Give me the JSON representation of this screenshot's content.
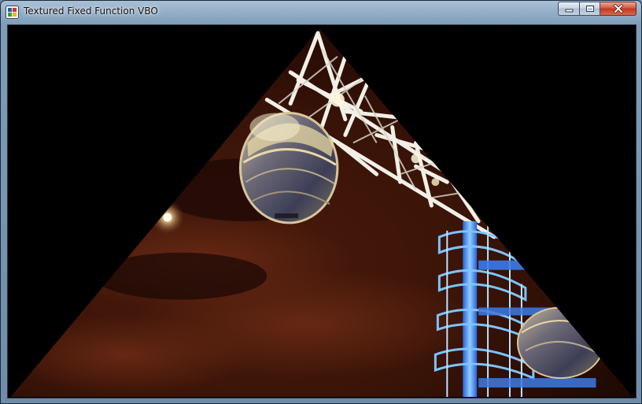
{
  "window": {
    "title": "Textured Fixed Function VBO",
    "icon": "app-window-icon"
  },
  "caption_buttons": {
    "minimize_icon": "minimize-icon",
    "maximize_icon": "maximize-icon",
    "close_icon": "close-icon"
  },
  "viewport": {
    "background": "#000000",
    "content": "textured-triangle"
  },
  "colors": {
    "sky_dark": "#1a0804",
    "sky_warm": "#5a2010",
    "structure_white": "#f2efe6",
    "staircase_blue": "#5fa8ff",
    "close_red": "#c4371c"
  }
}
